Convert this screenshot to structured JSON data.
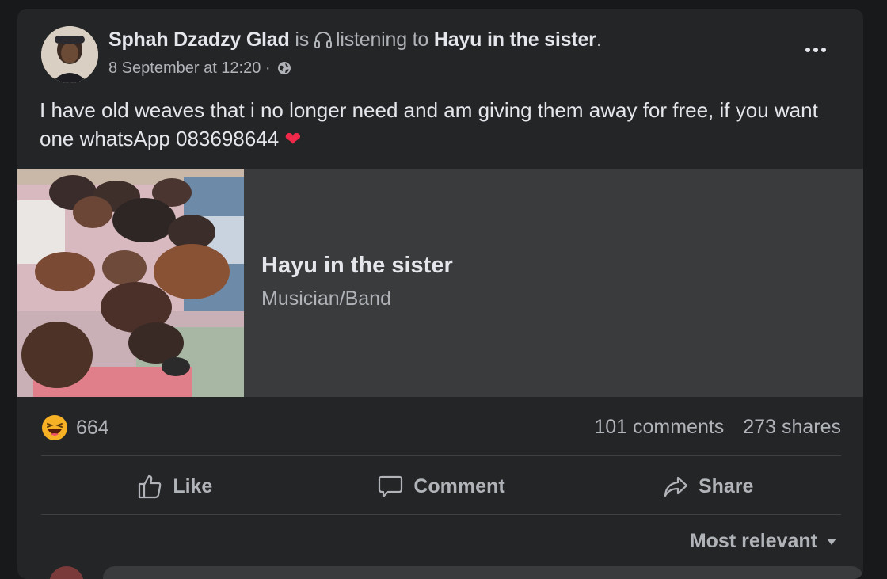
{
  "post": {
    "author": "Sphah Dzadzy Glad",
    "activity_prefix": "is",
    "activity_verb": "listening to",
    "activity_target": "Hayu in the sister",
    "activity_suffix": ".",
    "timestamp": "8 September at 12:20",
    "meta_separator": " · ",
    "privacy_icon": "globe-icon",
    "text": "I have old weaves that i no longer need and am giving them away for free, if you want one whatsApp 083698644",
    "text_emoji": "❤"
  },
  "attachment": {
    "title": "Hayu in the sister",
    "subtitle": "Musician/Band"
  },
  "engagement": {
    "reaction_icon": "haha-emoji-icon",
    "reaction_count": "664",
    "comments": "101 comments",
    "shares": "273 shares"
  },
  "actions": {
    "like": "Like",
    "comment": "Comment",
    "share": "Share"
  },
  "comments_sort": {
    "label": "Most relevant"
  },
  "colors": {
    "page_bg": "#18191a",
    "card_bg": "#242526",
    "attachment_bg": "#3a3b3c",
    "primary_text": "#e4e6eb",
    "secondary_text": "#b0b3b8",
    "heart": "#f0284a",
    "haha_yellow": "#f7b125"
  }
}
